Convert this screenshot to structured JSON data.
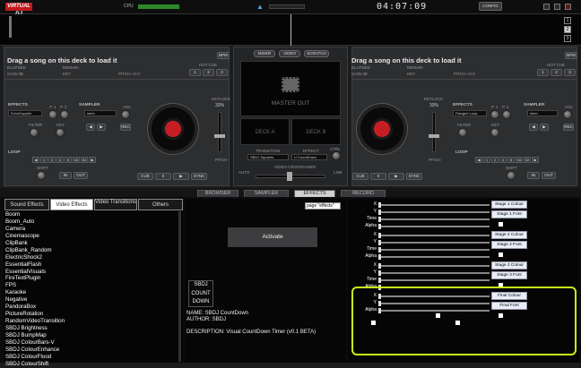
{
  "app": {
    "logo": "VIRTUAL DJ",
    "cpu_label": "CPU",
    "clock": "04:07:09",
    "config_label": "CONFIG",
    "window_buttons": [
      "_",
      "□",
      "x"
    ],
    "side_buttons": [
      "1",
      "2",
      "3"
    ]
  },
  "deck_left": {
    "title": "Drag a song on this deck to load it",
    "elapsed": "ELAPSED",
    "remain": "REMAIN",
    "gain": "GAIN dB",
    "key": "KEY",
    "pitch": "PITCH +0.0",
    "bpm_label": "BPM",
    "hotcue_label": "HOT CUE",
    "hotcues": [
      "1",
      "2",
      "3"
    ],
    "effects_label": "EFFECTS",
    "effect_value": "EchoDoppler",
    "p1": "P. 1",
    "p2": "P. 2",
    "filter_label": "FILTER",
    "key_label": "KEY",
    "sampler_label": "SAMPLER",
    "sampler_value": "siren",
    "vol_label": "VOL",
    "rec_label": "REC",
    "loop_label": "LOOP",
    "loop_values": [
      "1",
      "2",
      "4",
      "8",
      "16",
      "32"
    ],
    "shift_label": "SHIFT",
    "in_label": "IN",
    "out_label": "OUT",
    "keylock_label": "KEYLOCK",
    "keylock_value": "33%",
    "cue_label": "CUE",
    "play_label": "▶",
    "pause_label": "II",
    "sync_label": "SYNC",
    "pitch_label": "PITCH"
  },
  "deck_right": {
    "title": "Drag a song on this deck to load it",
    "elapsed": "ELAPSED",
    "remain": "REMAIN",
    "gain": "GAIN dB",
    "key": "KEY",
    "pitch": "PITCH +0.0",
    "bpm_label": "BPM",
    "hotcue_label": "HOT CUE",
    "hotcues": [
      "1",
      "2",
      "3"
    ],
    "effects_label": "EFFECTS",
    "effect_value": "Flanged Loop",
    "p1": "P. 1",
    "p2": "P. 2",
    "filter_label": "FILTER",
    "key_label": "KEY",
    "sampler_label": "SAMPLER",
    "sampler_value": "siren",
    "vol_label": "VOL",
    "rec_label": "REC",
    "loop_label": "LOOP",
    "loop_values": [
      "1",
      "2",
      "4",
      "8",
      "16",
      "32"
    ],
    "shift_label": "SHIFT",
    "in_label": "IN",
    "out_label": "OUT",
    "keylock_label": "KEYLOCK",
    "keylock_value": "33%",
    "cue_label": "CUE",
    "play_label": "▶",
    "pause_label": "II",
    "sync_label": "SYNC",
    "pitch_label": "PITCH"
  },
  "center": {
    "tabs": [
      "MIXER",
      "VIDEO",
      "SCRATCH"
    ],
    "master_out": "MASTER OUT",
    "deck_a": "DECK A",
    "deck_b": "DECK B",
    "transition_label": "TRANSITION",
    "transition_value": "SBDJ Squares",
    "effect_label": "EFFECT",
    "effect_value": "U CountDown",
    "ctrl_label": "CTRL",
    "crossfader_label": "VIDEO CROSSFADER",
    "auto_label": "AUTO",
    "link_label": "LINK"
  },
  "bottom_tabs": [
    "BROWSER",
    "SAMPLER",
    "EFFECTS",
    "RECORD"
  ],
  "left_tabs": [
    "Sound Effects",
    "Video Effects",
    "Video Transitions",
    "Others"
  ],
  "effects_list": [
    "Boom",
    "Boom_Auto",
    "Camera",
    "Cinemascope",
    "ClipBank",
    "ClipBank_Random",
    "ElectricShock2",
    "EssentialFlash",
    "EssentialVisuals",
    "FireTextPlugin",
    "FPS",
    "Karaoke",
    "Negative",
    "PandoraBox",
    "PictureRotation",
    "RandomVideoTransition",
    "SBDJ Brightness",
    "SBDJ BumpMap",
    "SBDJ ColourBars-V",
    "SBDJ ColourEnhance",
    "SBDJ ColourFlood",
    "SBDJ ColourShift"
  ],
  "middle": {
    "search_value": "page \"effects\"",
    "activate_label": "Activate",
    "countdown_text": [
      "SBDJ",
      "COUNT",
      "DOWN"
    ],
    "name": "NAME: SBDJ CountDown",
    "author": "AUTHOR: SBDJ",
    "description": "DESCRIPTION: Visual CountDown Timer (v0.1 BETA)"
  },
  "params": {
    "row_labels": [
      "X",
      "Y",
      "Time",
      "Alpha"
    ],
    "buttons": [
      "Stage 1 Colour",
      "Stage 1 Font",
      "Stage 2 Colour",
      "Stage 2 Font",
      "Stage 3 Colour",
      "Stage 3 Font",
      "Final Colour",
      "Final Font"
    ]
  },
  "colors": {
    "accent_red": "#c71e26",
    "highlight": "#c8f21a",
    "clock": "#e8e8e8"
  }
}
